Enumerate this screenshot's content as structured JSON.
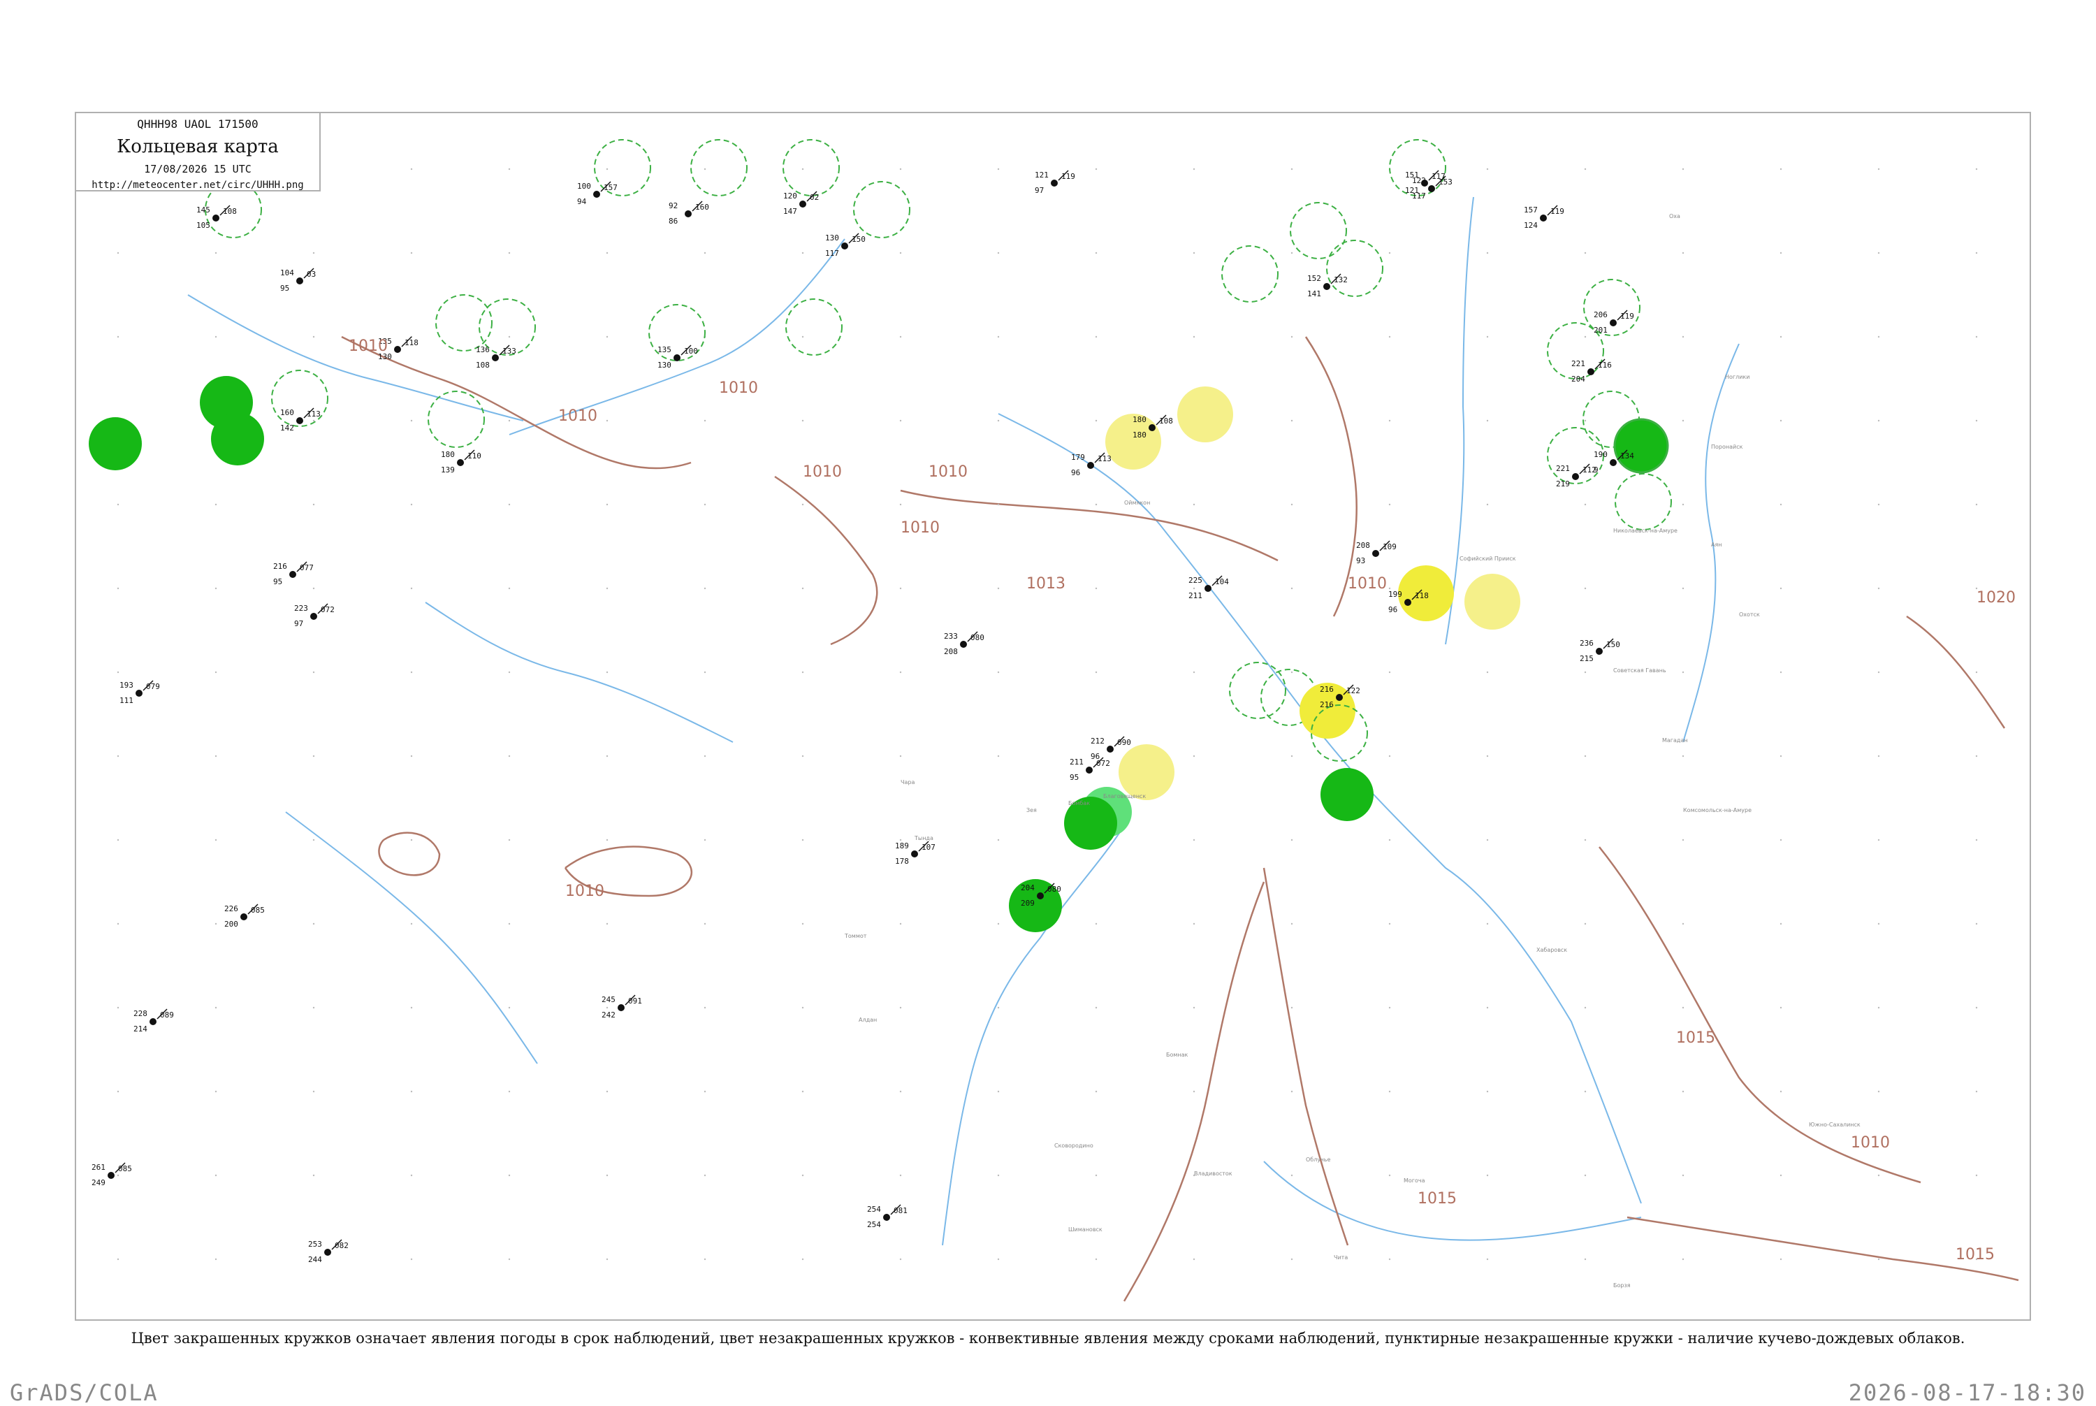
{
  "header": {
    "code_line": "QHHH98  UAOL  171500",
    "title": "Кольцевая карта",
    "time_line": "17/08/2026 15 UTC",
    "url": "http://meteocenter.net/circ/UHHH.png"
  },
  "caption": "Цвет закрашенных кружков означает явления погоды в срок наблюдений, цвет незакрашенных кружков - конвективные явления между сроками наблюдений, пунктирные незакрашенные кружки - наличие кучево-дождевых облаков.",
  "footer": {
    "left": "GrADS/COLA",
    "right": "2026-08-17-18:30"
  },
  "map": {
    "colors": {
      "river": "#7ab8e8",
      "isobar": "#b07868",
      "dashed_circle": "#3cb043",
      "green_fill": "#16b816",
      "light_green_fill": "#5fe07a",
      "yellow_fill": "#f0ec3a",
      "pale_yellow_fill": "#f5f08a"
    },
    "isobar_labels": [
      "1010",
      "1010",
      "1010",
      "1010",
      "1010",
      "1010",
      "1010",
      "1010",
      "1010",
      "1013",
      "1015",
      "1015",
      "1015",
      "1020"
    ],
    "stations": [
      {
        "t": "145",
        "td": "105",
        "p": "108"
      },
      {
        "t": "104",
        "td": "95",
        "p": "03"
      },
      {
        "t": "100",
        "td": "94",
        "p": "157"
      },
      {
        "t": "92",
        "td": "86",
        "p": "160"
      },
      {
        "t": "120",
        "td": "147",
        "p": "02"
      },
      {
        "t": "130",
        "td": "117",
        "p": "150"
      },
      {
        "t": "121",
        "td": "97",
        "p": "119"
      },
      {
        "t": "135",
        "td": "130",
        "p": "118"
      },
      {
        "t": "136",
        "td": "108",
        "p": "133"
      },
      {
        "t": "135",
        "td": "130",
        "p": "100"
      },
      {
        "t": "160",
        "td": "142",
        "p": "113"
      },
      {
        "t": "180",
        "td": "139",
        "p": "110"
      },
      {
        "t": "179",
        "td": "96",
        "p": "113"
      },
      {
        "t": "180",
        "td": "180",
        "p": "108"
      },
      {
        "t": "152",
        "td": "141",
        "p": "132"
      },
      {
        "t": "122",
        "td": "117",
        "p": "153"
      },
      {
        "t": "206",
        "td": "201",
        "p": "119"
      },
      {
        "t": "221",
        "td": "204",
        "p": "116"
      },
      {
        "t": "190",
        "td": "9",
        "p": "134"
      },
      {
        "t": "221",
        "td": "219",
        "p": "112"
      },
      {
        "t": "208",
        "td": "93",
        "p": "109"
      },
      {
        "t": "199",
        "td": "96",
        "p": "118"
      },
      {
        "t": "225",
        "td": "211",
        "p": "104"
      },
      {
        "t": "216",
        "td": "216",
        "p": "122"
      },
      {
        "t": "212",
        "td": "96",
        "p": "090"
      },
      {
        "t": "211",
        "td": "95",
        "p": "072"
      },
      {
        "t": "204",
        "td": "209",
        "p": "080"
      },
      {
        "t": "236",
        "td": "215",
        "p": "150"
      },
      {
        "t": "254",
        "td": "254",
        "p": "081"
      },
      {
        "t": "151",
        "td": "121",
        "p": "117"
      },
      {
        "t": "157",
        "td": "124",
        "p": "119"
      },
      {
        "t": "216",
        "td": "95",
        "p": "077"
      },
      {
        "t": "223",
        "td": "97",
        "p": "072"
      },
      {
        "t": "193",
        "td": "111",
        "p": "079"
      },
      {
        "t": "226",
        "td": "200",
        "p": "085"
      },
      {
        "t": "228",
        "td": "214",
        "p": "089"
      },
      {
        "t": "261",
        "td": "249",
        "p": "085"
      },
      {
        "t": "253",
        "td": "244",
        "p": "082"
      },
      {
        "t": "245",
        "td": "242",
        "p": "091"
      },
      {
        "t": "189",
        "td": "178",
        "p": "107"
      },
      {
        "t": "233",
        "td": "208",
        "p": "080"
      }
    ],
    "station_names": [
      "Оймякон",
      "Магадан",
      "Охотск",
      "Аян",
      "Николаевск-на-Амуре",
      "Хабаровск",
      "Благовещенск",
      "Комсомольск-на-Амуре",
      "Южно-Сахалинск",
      "Владивосток",
      "Томмот",
      "Алдан",
      "Зея",
      "Бомнак",
      "Тында",
      "Чара",
      "Сковородино",
      "Могоча",
      "Чита",
      "Борзя",
      "Бомбак",
      "Софийский Прииск",
      "Шимановск",
      "Облучье",
      "Советская Гавань",
      "Поронайск",
      "Оха",
      "Ноглики"
    ]
  }
}
